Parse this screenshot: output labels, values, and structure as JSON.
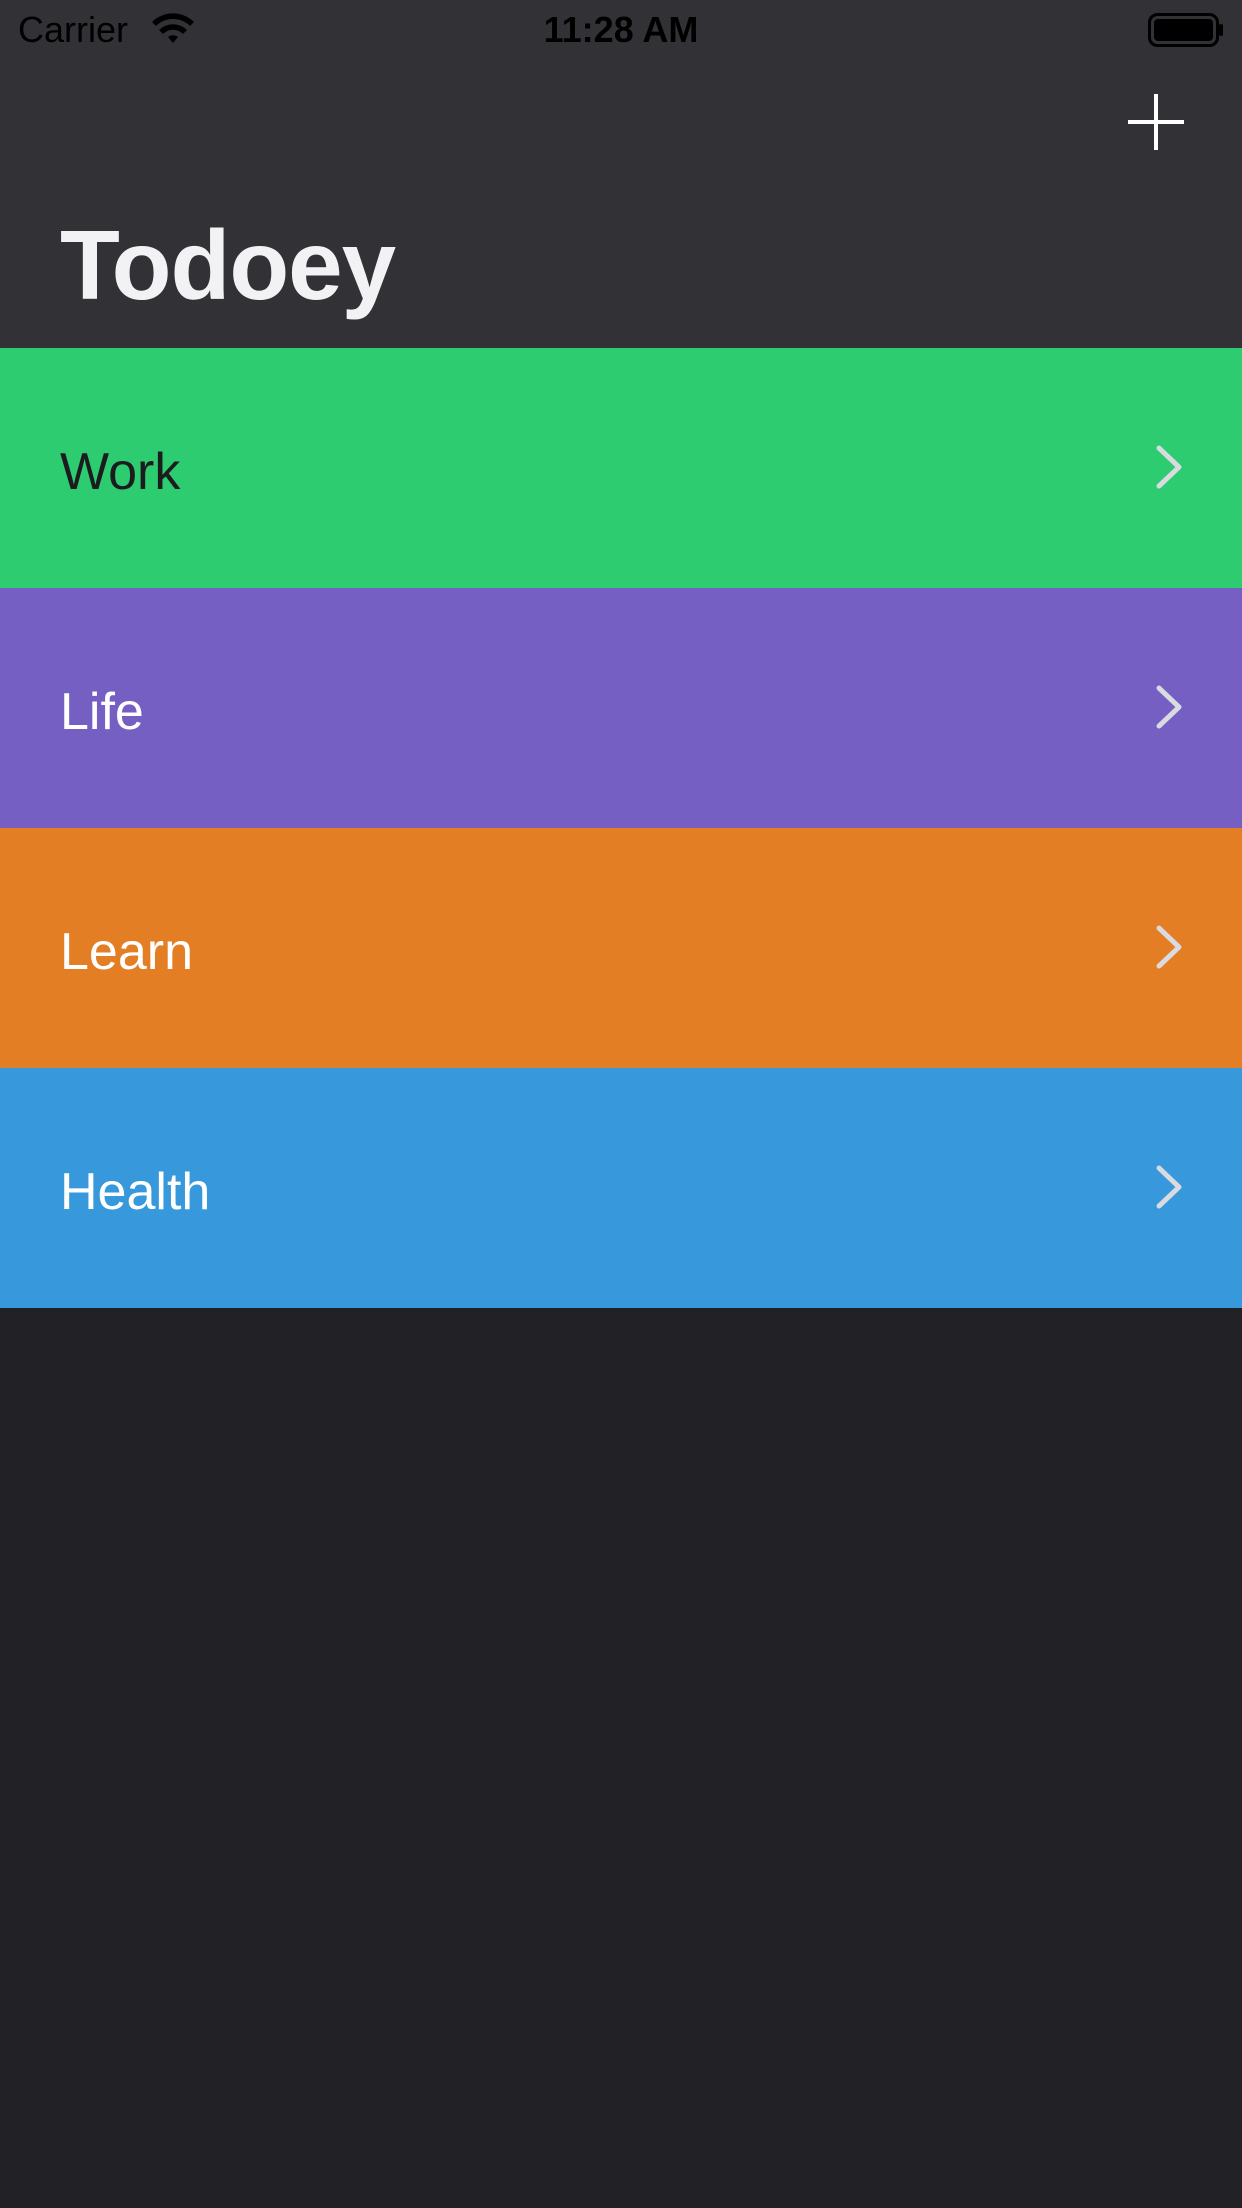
{
  "status_bar": {
    "carrier": "Carrier",
    "time": "11:28 AM",
    "wifi_icon": "wifi-icon",
    "battery_icon": "battery-icon"
  },
  "nav": {
    "title": "Todoey",
    "add_icon": "plus-icon"
  },
  "categories": [
    {
      "label": "Work",
      "color": "#2ECC71",
      "text_color": "#1c1c1e"
    },
    {
      "label": "Life",
      "color": "#765FC3",
      "text_color": "#ffffff"
    },
    {
      "label": "Learn",
      "color": "#E47E24",
      "text_color": "#ffffff"
    },
    {
      "label": "Health",
      "color": "#3799DB",
      "text_color": "#ffffff"
    }
  ],
  "colors": {
    "nav_background": "#323136",
    "page_background": "#222126",
    "chevron": "#D9DBE0"
  }
}
